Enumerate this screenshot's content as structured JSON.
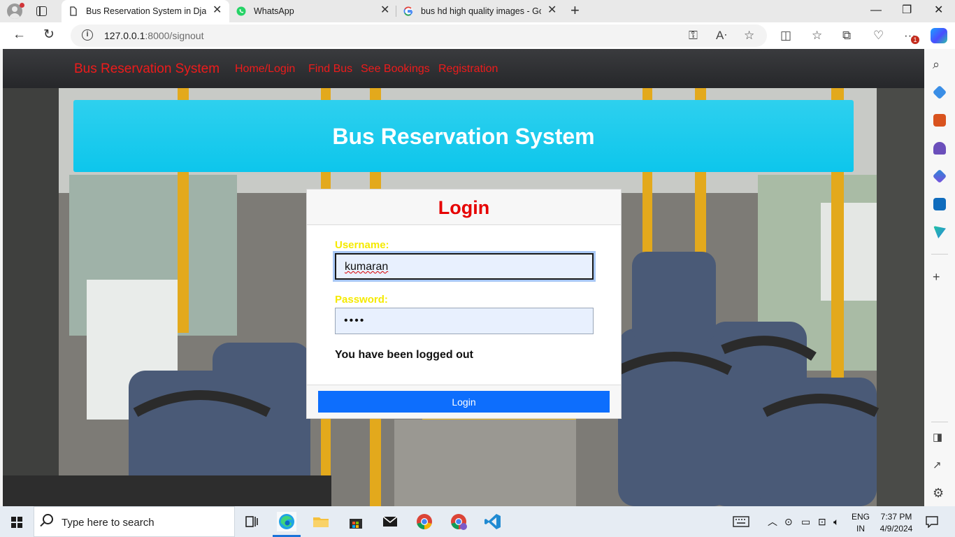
{
  "browser": {
    "tabs": [
      {
        "title": "Bus Reservation System in Django",
        "close": "✕"
      },
      {
        "title": "WhatsApp",
        "close": "✕"
      },
      {
        "title": "bus hd high quality images - Google",
        "close": "✕"
      }
    ],
    "new_tab": "+",
    "window_controls": {
      "minimize": "—",
      "maximize": "❐",
      "close": "✕"
    },
    "url": {
      "host": "127.0.0.1",
      "path": ":8000/signout"
    },
    "notification_badge": "1",
    "icons": [
      "back-icon",
      "refresh-icon",
      "info-icon",
      "key-icon",
      "read-aloud-icon",
      "favorite-icon",
      "split-screen-icon",
      "favorites-icon",
      "collections-icon",
      "browser-essentials-icon",
      "more-icon",
      "copilot-icon"
    ]
  },
  "site": {
    "brand": "Bus Reservation System",
    "nav": [
      "Home/Login",
      "Find Bus",
      "See Bookings",
      "Registration"
    ],
    "hero_title": "Bus Reservation System"
  },
  "login": {
    "title": "Login",
    "username_label": "Username:",
    "username_value": "kumaran",
    "password_label": "Password:",
    "password_value": "••••",
    "message": "You have been logged out",
    "button": "Login"
  },
  "sidebar": {
    "icons": [
      "search-icon",
      "shopping-icon",
      "tools-icon",
      "games-icon",
      "microsoft365-icon",
      "outlook-icon",
      "drop-icon",
      "add-icon",
      "sidebar-toggle-icon",
      "external-link-icon",
      "settings-icon"
    ]
  },
  "taskbar": {
    "search_placeholder": "Type here to search",
    "apps": [
      "task-view-icon",
      "edge-icon",
      "file-explorer-icon",
      "store-icon",
      "mail-icon",
      "chrome-icon",
      "chrome-profile-icon",
      "vscode-icon"
    ],
    "language": "ENG",
    "region": "IN",
    "time": "7:37 PM",
    "date": "4/9/2024"
  },
  "colors": {
    "brand_red": "#ee1b1b",
    "hero_cyan": "#14c8ee",
    "label_yellow": "#f5ea00",
    "button_blue": "#0d6efd"
  }
}
